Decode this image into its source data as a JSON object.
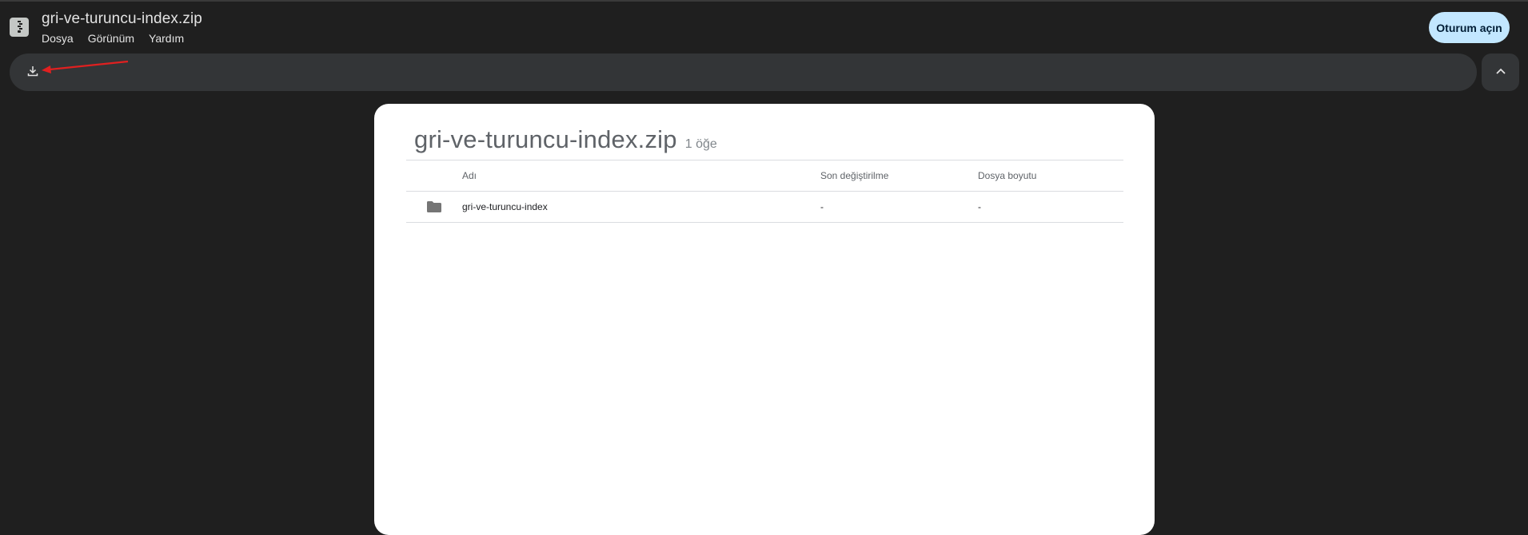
{
  "window": {
    "title": "gri-ve-turuncu-index.zip"
  },
  "menu": {
    "items": [
      "Dosya",
      "Görünüm",
      "Yardım"
    ]
  },
  "header": {
    "signin_label": "Oturum açın"
  },
  "icons": {
    "app": "zip-archive-icon",
    "download": "download-icon",
    "collapse": "chevron-up-icon",
    "folder": "folder-icon",
    "annotation": "red-arrow"
  },
  "colors": {
    "background": "#1f1f1f",
    "toolbar": "#333537",
    "signin_bg": "#c2e7ff",
    "annotation": "#e02020"
  },
  "archive": {
    "name": "gri-ve-turuncu-index.zip",
    "item_count": "1 öğe",
    "columns": {
      "name": "Adı",
      "modified": "Son değiştirilme",
      "size": "Dosya boyutu"
    },
    "rows": [
      {
        "name": "gri-ve-turuncu-index",
        "modified": "-",
        "size": "-"
      }
    ]
  }
}
